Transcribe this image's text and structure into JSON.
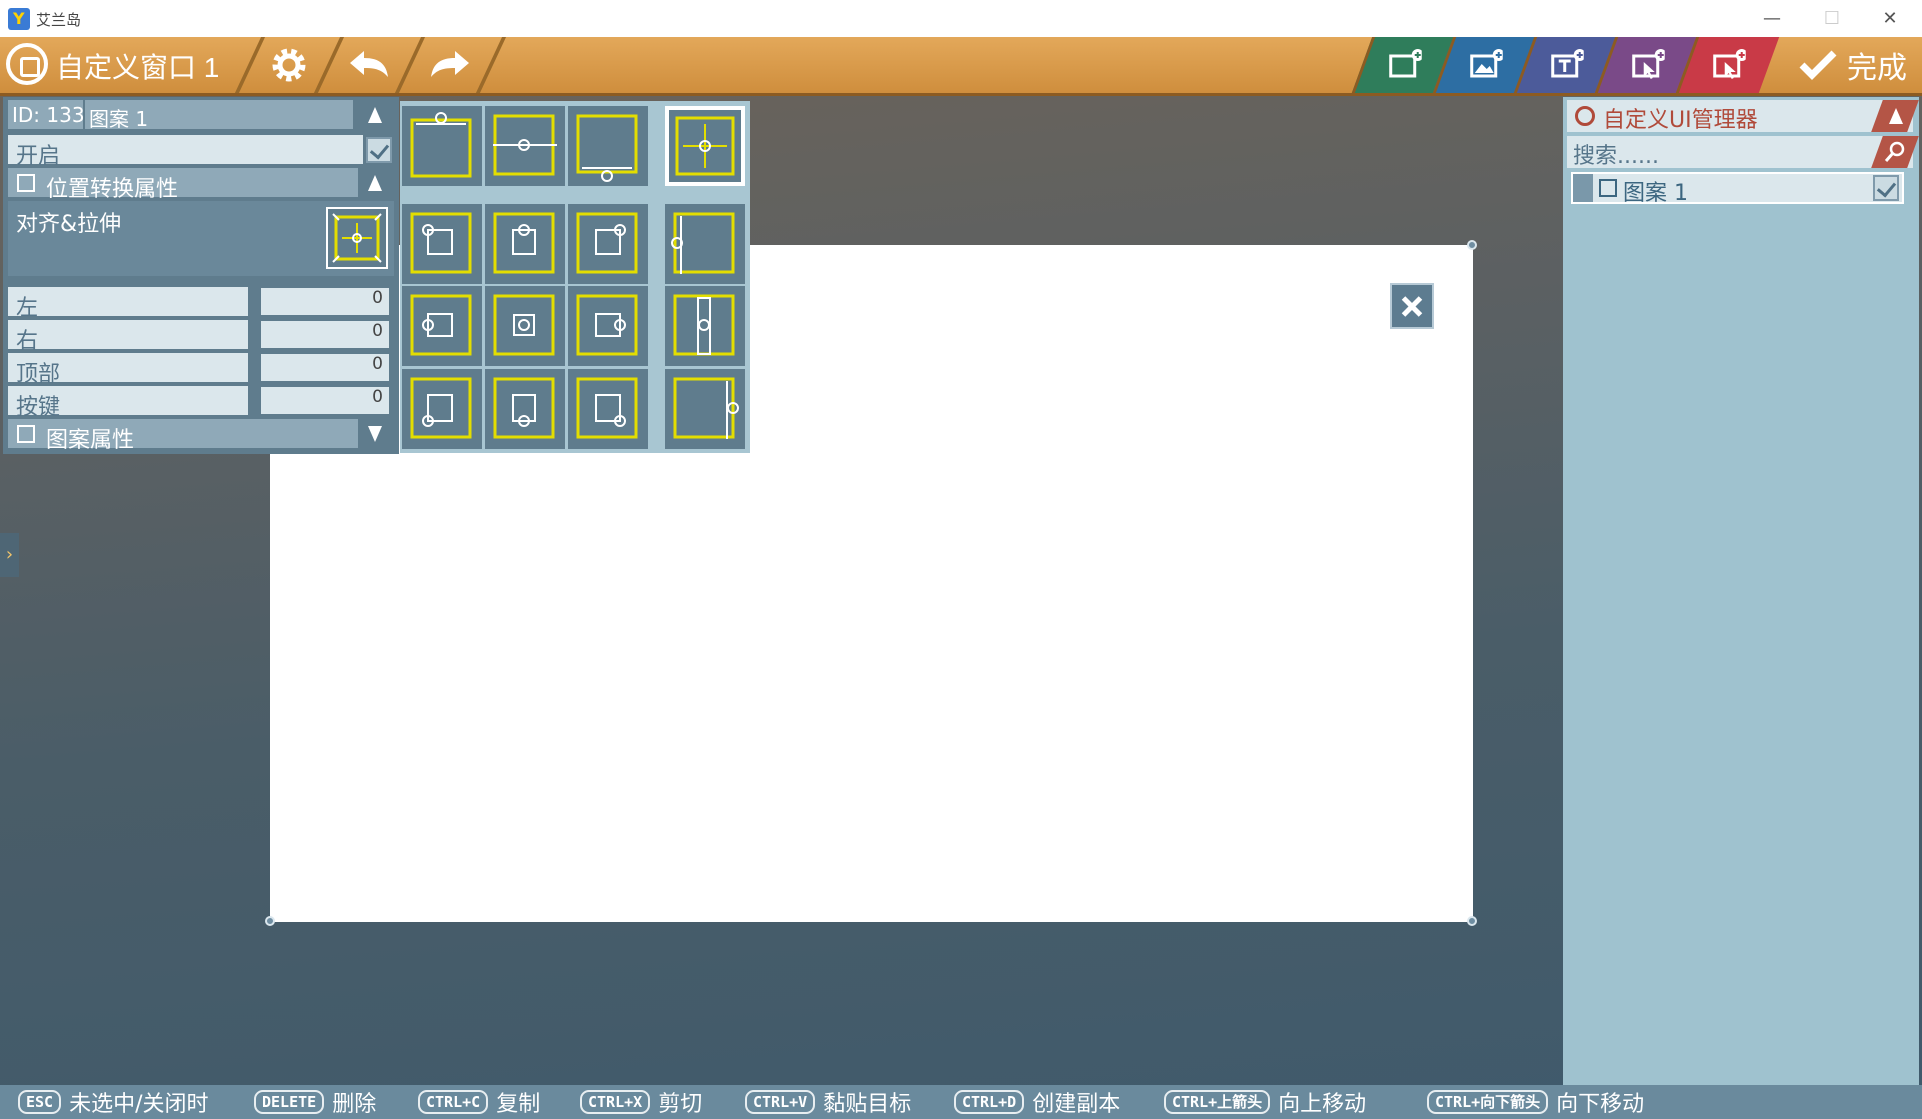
{
  "os_window": {
    "title": "艾兰岛",
    "minimize": "—",
    "maximize": "☐",
    "close": "✕"
  },
  "toolbar": {
    "title": "自定义窗口 1",
    "done_label": "完成",
    "right_buttons": [
      {
        "name": "add-frame",
        "color": "#2f7d5b"
      },
      {
        "name": "add-image",
        "color": "#2d6ea3"
      },
      {
        "name": "add-text",
        "color": "#4c5b9a"
      },
      {
        "name": "add-button",
        "color": "#7a4a88"
      },
      {
        "name": "add-hot-button",
        "color": "#c93a47"
      }
    ]
  },
  "left_panel": {
    "id_label": "ID: 133",
    "name_value": "图案 1",
    "enabled_label": "开启",
    "section_position": "位置转换属性",
    "align_label": "对齐&拉伸",
    "fields": [
      {
        "label": "左",
        "value": "0"
      },
      {
        "label": "右",
        "value": "0"
      },
      {
        "label": "顶部",
        "value": "0"
      },
      {
        "label": "按键",
        "value": "0"
      }
    ],
    "section_pattern": "图案属性"
  },
  "right_panel": {
    "title": "自定义UI管理器",
    "search_placeholder": "搜索......",
    "items": [
      {
        "label": "图案 1",
        "checked": true
      }
    ]
  },
  "statusbar": {
    "items": [
      {
        "key": "ESC",
        "label": "未选中/关闭时"
      },
      {
        "key": "DELETE",
        "label": "删除"
      },
      {
        "key": "CTRL+C",
        "label": "复制"
      },
      {
        "key": "CTRL+X",
        "label": "剪切"
      },
      {
        "key": "CTRL+V",
        "label": "黏贴目标"
      },
      {
        "key": "CTRL+D",
        "label": "创建副本"
      },
      {
        "key": "CTRL+上箭头",
        "label": "向上移动"
      },
      {
        "key": "CTRL+向下箭头",
        "label": "向下移动"
      }
    ]
  },
  "colors": {
    "toolbar_orange": "#d99a48",
    "panel_blue": "#5f7c8d",
    "accent_yellow": "#e3de00"
  }
}
